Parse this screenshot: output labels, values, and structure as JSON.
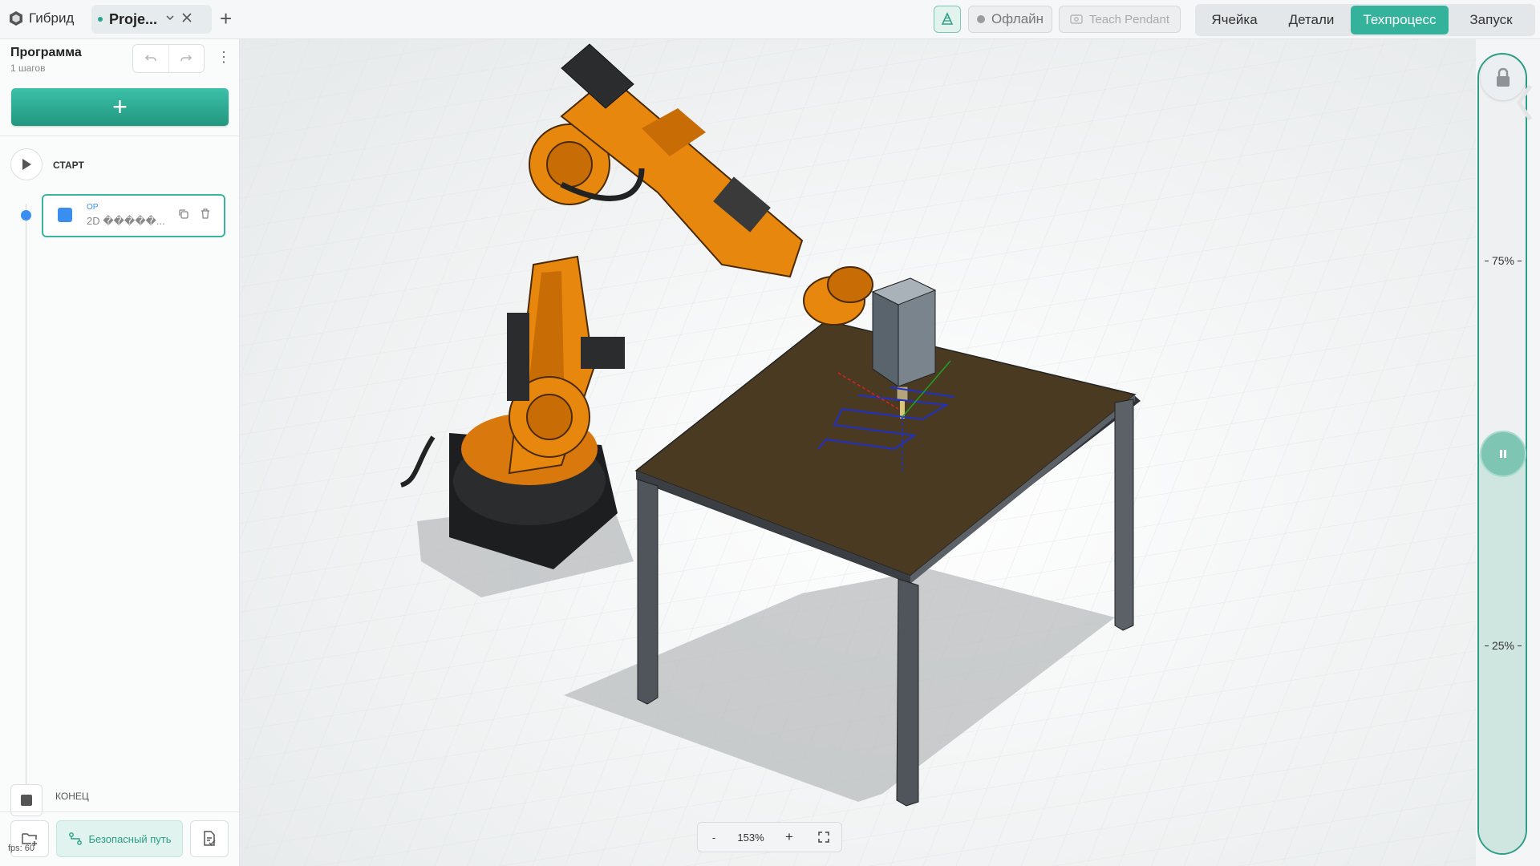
{
  "header": {
    "app_name": "Гибрид",
    "project_tab": "Proje...",
    "status": "Офлайн",
    "teach_pendant": "Teach Pendant",
    "modes": [
      {
        "label": "Ячейка",
        "active": false
      },
      {
        "label": "Детали",
        "active": false
      },
      {
        "label": "Техпроцесс",
        "active": true
      },
      {
        "label": "Запуск",
        "active": false
      }
    ]
  },
  "sidebar": {
    "title": "Программа",
    "subtitle": "1 шагов",
    "add_label": "+",
    "start_label": "СТАРТ",
    "steps": [
      {
        "type": "OP",
        "name": "2D �����..."
      }
    ],
    "end_label": "КОНЕЦ",
    "safe_path_label": "Безопасный путь",
    "fps": "fps: 60"
  },
  "viewport": {
    "zoom_minus": "-",
    "zoom_value": "153%",
    "zoom_plus": "+"
  },
  "speed": {
    "fill_percent": 50,
    "ticks": [
      {
        "label": "75%"
      },
      {
        "label": "25%"
      }
    ]
  },
  "colors": {
    "accent": "#34b29c",
    "robot_orange": "#e8870e",
    "table_top": "#4a3a22",
    "step_blue": "#3a8ef0"
  }
}
